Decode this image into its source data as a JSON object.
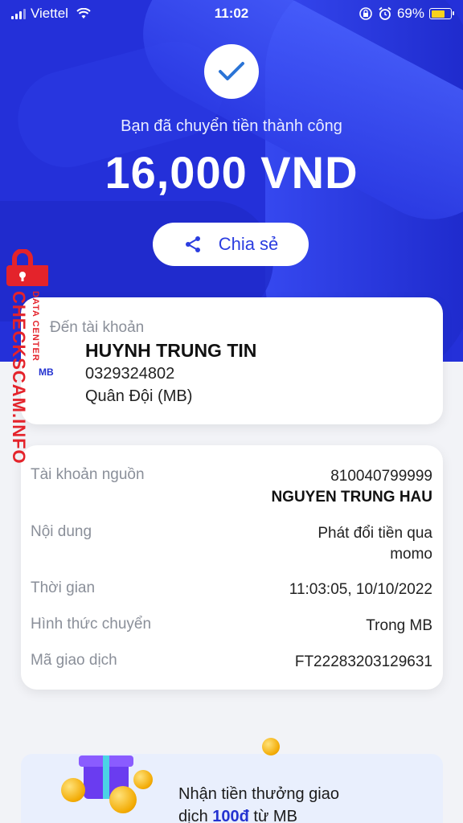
{
  "status_bar": {
    "carrier": "Viettel",
    "time": "11:02",
    "battery": "69%",
    "battery_level": 0.69
  },
  "header": {
    "success_message": "Bạn đã chuyển tiền thành công",
    "amount": "16,000 VND",
    "share_label": "Chia sẻ"
  },
  "recipient": {
    "label": "Đến tài khoản",
    "name": "HUYNH TRUNG TIN",
    "account": "0329324802",
    "bank": "Quân Đội (MB)",
    "bank_logo": "MB"
  },
  "details": [
    {
      "label": "Tài khoản nguồn",
      "value": "810040799999",
      "value2": "NGUYEN TRUNG HAU"
    },
    {
      "label": "Nội dung",
      "value": "Phát đổi tiền qua",
      "value2": "momo"
    },
    {
      "label": "Thời gian",
      "value": "11:03:05, 10/10/2022"
    },
    {
      "label": "Hình thức chuyển",
      "value": "Trong MB"
    },
    {
      "label": "Mã giao dịch",
      "value": "FT22283203129631"
    }
  ],
  "promo": {
    "line1": "Nhận tiền thưởng giao",
    "line2_pre": "dịch ",
    "line2_highlight": "100đ",
    "line2_post": " từ MB"
  },
  "watermark": {
    "main": "CHECKSCAM.INFO",
    "sub": "DATA CENTER"
  },
  "colors": {
    "brand_blue": "#2430d9",
    "accent_text": "#2b3de0",
    "watermark_red": "#e4232b"
  }
}
